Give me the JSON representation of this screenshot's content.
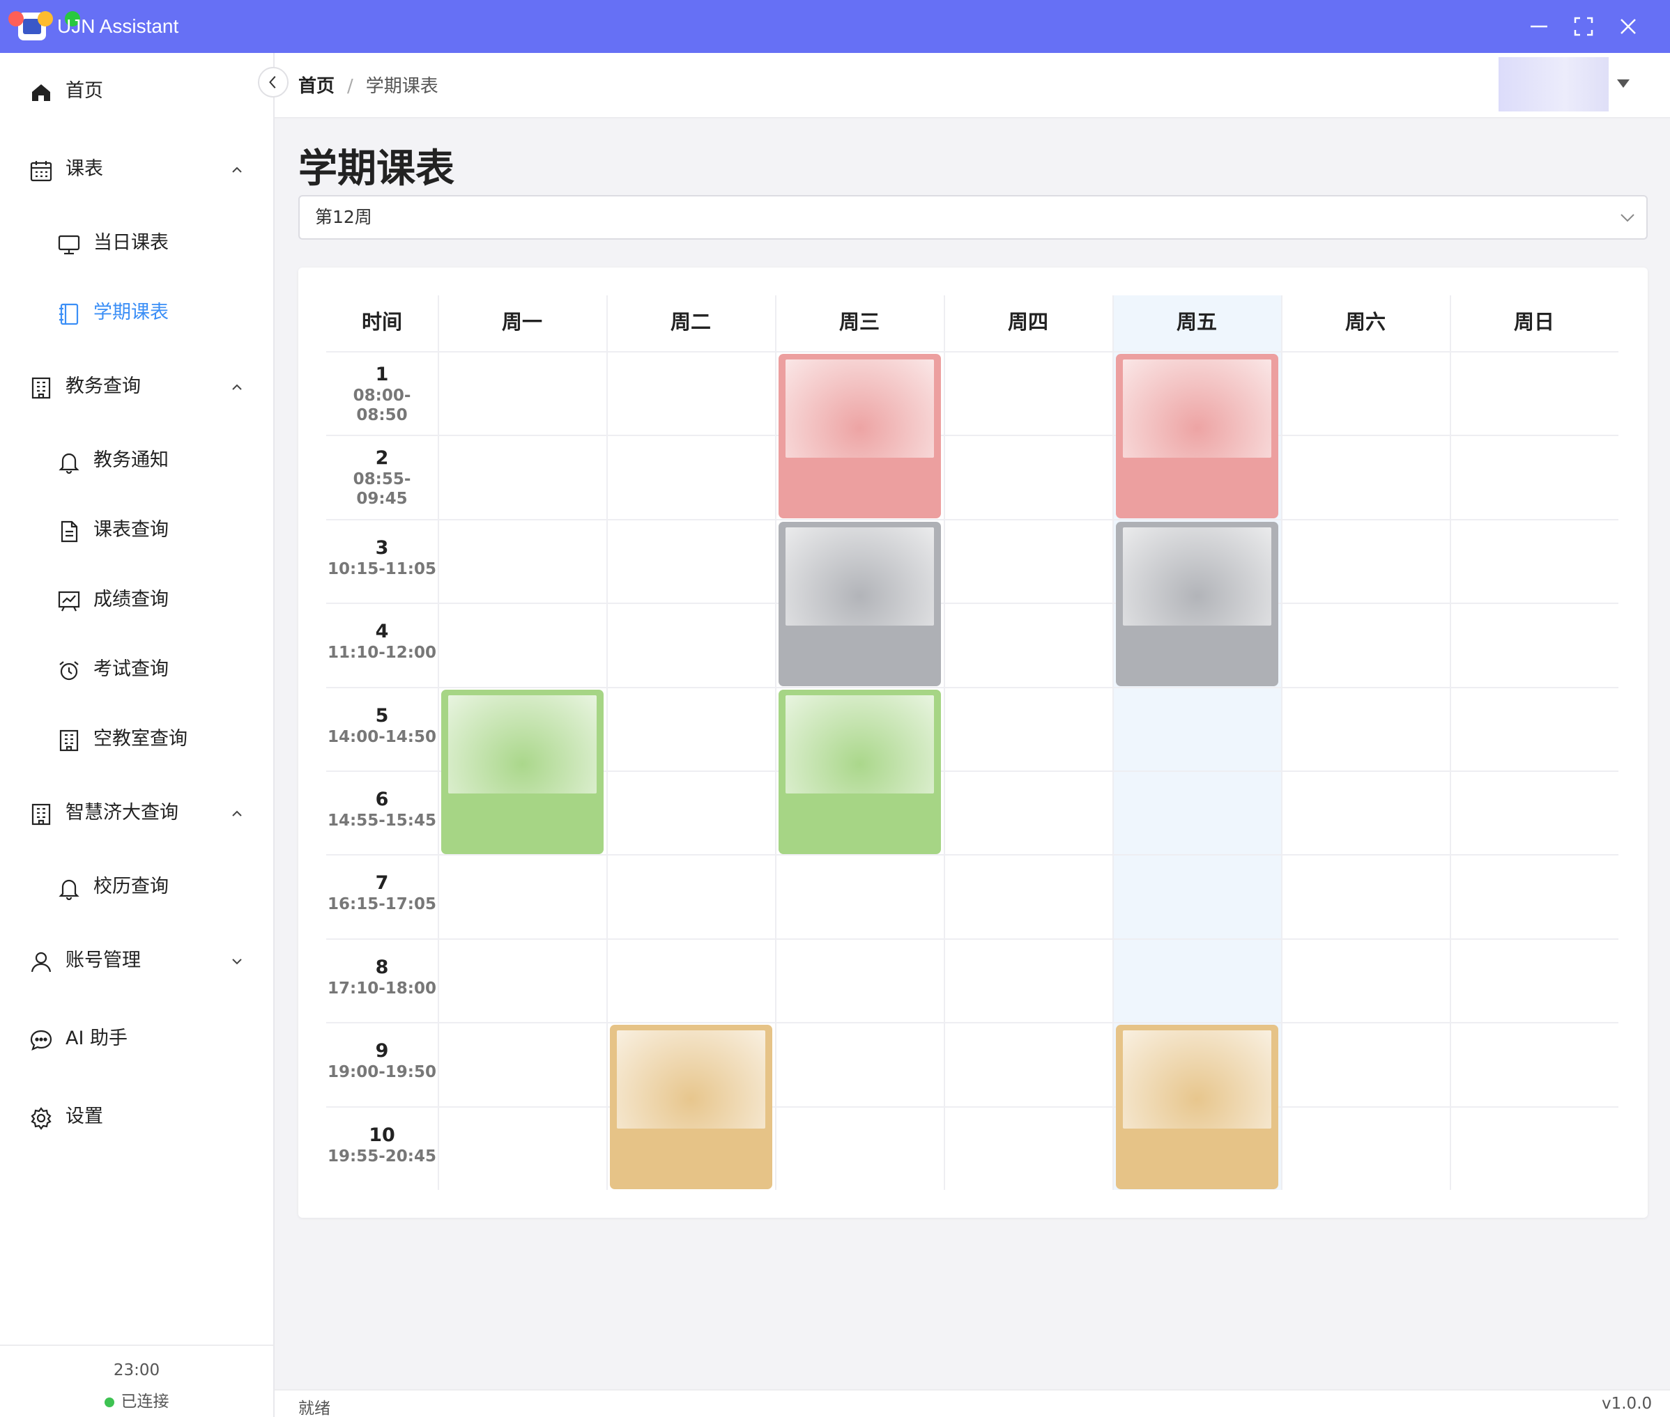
{
  "app": {
    "title": "UJN Assistant"
  },
  "sidebar": {
    "items": [
      {
        "label": "首页",
        "icon": "home-icon"
      },
      {
        "label": "课表",
        "icon": "calendar-icon",
        "expanded": true
      },
      {
        "label": "当日课表",
        "icon": "monitor-icon"
      },
      {
        "label": "学期课表",
        "icon": "notebook-icon",
        "active": true
      },
      {
        "label": "教务查询",
        "icon": "building-icon",
        "expanded": true
      },
      {
        "label": "教务通知",
        "icon": "bell-icon"
      },
      {
        "label": "课表查询",
        "icon": "document-icon"
      },
      {
        "label": "成绩查询",
        "icon": "chart-board-icon"
      },
      {
        "label": "考试查询",
        "icon": "alarm-clock-icon"
      },
      {
        "label": "空教室查询",
        "icon": "building-icon"
      },
      {
        "label": "智慧济大查询",
        "icon": "building-icon",
        "expanded": true
      },
      {
        "label": "校历查询",
        "icon": "bell-icon"
      },
      {
        "label": "账号管理",
        "icon": "user-icon",
        "expanded": false
      },
      {
        "label": "AI 助手",
        "icon": "chat-bubble-icon"
      },
      {
        "label": "设置",
        "icon": "gear-icon"
      }
    ],
    "footer": {
      "time": "23:00",
      "status": "已连接",
      "status_color": "#3ec252"
    }
  },
  "breadcrumb": {
    "home": "首页",
    "separator": "/",
    "current": "学期课表"
  },
  "page": {
    "title": "学期课表"
  },
  "week_select": {
    "value": "第12周"
  },
  "timetable": {
    "time_header": "时间",
    "days": [
      "周一",
      "周二",
      "周三",
      "周四",
      "周五",
      "周六",
      "周日"
    ],
    "highlight_day": "周五",
    "periods": [
      {
        "num": "1",
        "time": "08:00-",
        "time2": "08:50"
      },
      {
        "num": "2",
        "time": "08:55-",
        "time2": "09:45"
      },
      {
        "num": "3",
        "time": "10:15-11:05"
      },
      {
        "num": "4",
        "time": "11:10-12:00"
      },
      {
        "num": "5",
        "time": "14:00-14:50"
      },
      {
        "num": "6",
        "time": "14:55-15:45"
      },
      {
        "num": "7",
        "time": "16:15-17:05"
      },
      {
        "num": "8",
        "time": "17:10-18:00"
      },
      {
        "num": "9",
        "time": "19:00-19:50"
      },
      {
        "num": "10",
        "time": "19:55-20:45"
      }
    ],
    "courses": [
      {
        "day": "周三",
        "start": 1,
        "end": 2,
        "color": "#ec9f9f"
      },
      {
        "day": "周五",
        "start": 1,
        "end": 2,
        "color": "#ec9f9f"
      },
      {
        "day": "周三",
        "start": 3,
        "end": 4,
        "color": "#aeb0b5"
      },
      {
        "day": "周五",
        "start": 3,
        "end": 4,
        "color": "#aeb0b5"
      },
      {
        "day": "周一",
        "start": 5,
        "end": 6,
        "color": "#a6d585"
      },
      {
        "day": "周三",
        "start": 5,
        "end": 6,
        "color": "#a6d585"
      },
      {
        "day": "周二",
        "start": 9,
        "end": 10,
        "color": "#e6c387"
      },
      {
        "day": "周五",
        "start": 9,
        "end": 10,
        "color": "#e6c387"
      }
    ]
  },
  "statusbar": {
    "left": "就绪",
    "version": "v1.0.0"
  },
  "colors": {
    "titlebar": "#6670f5",
    "accent": "#3a8ef6",
    "highlight_column": "#eff6fd"
  }
}
